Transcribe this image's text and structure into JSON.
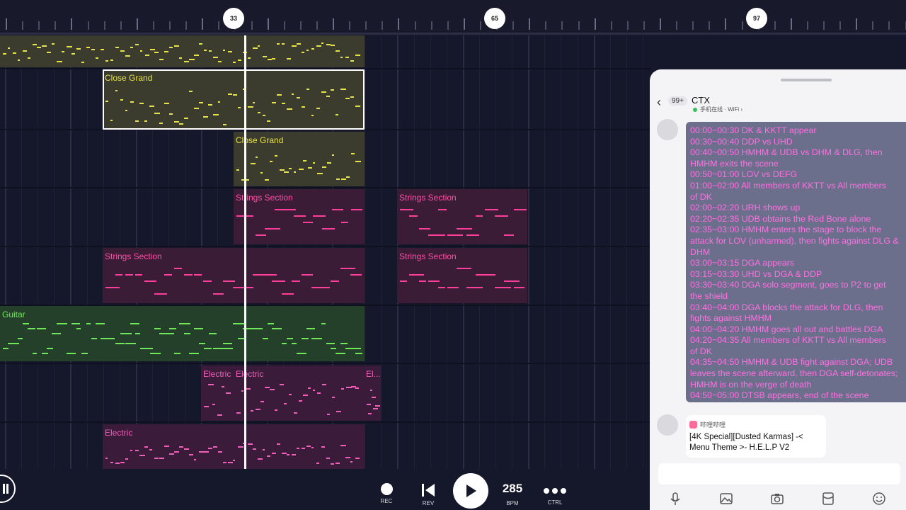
{
  "ruler": {
    "markers": [
      "33",
      "65",
      "97"
    ]
  },
  "tracks": {
    "clips": [
      {
        "id": "row1-a",
        "label": "",
        "color": "yellow"
      },
      {
        "id": "row2-a",
        "label": "Close Grand",
        "color": "yellow",
        "selected": true
      },
      {
        "id": "row3-a",
        "label": "Close Grand",
        "color": "yellow"
      },
      {
        "id": "row4-a",
        "label": "Strings Section",
        "color": "pink"
      },
      {
        "id": "row4-b",
        "label": "Strings Section",
        "color": "pink"
      },
      {
        "id": "row5-a",
        "label": "Strings Section",
        "color": "pink"
      },
      {
        "id": "row5-b",
        "label": "Strings Section",
        "color": "pink"
      },
      {
        "id": "row6-a",
        "label": "Guitar",
        "color": "green"
      },
      {
        "id": "row7-a",
        "label": "Electric",
        "color": "magenta"
      },
      {
        "id": "row7-b",
        "label": "Electric",
        "color": "magenta"
      },
      {
        "id": "row7-c",
        "label": "El...",
        "color": "magenta"
      },
      {
        "id": "row8-a",
        "label": "Electric",
        "color": "magenta"
      }
    ]
  },
  "transport": {
    "rec_label": "REC",
    "rev_label": "REV",
    "bpm_value": "285",
    "bpm_label": "BPM",
    "ctrl_label": "CTRL"
  },
  "chat": {
    "unread_badge": "99+",
    "contact_name": "CTX",
    "contact_status": "手机在线 · WiFi ›",
    "message_lines": [
      "00:00~00:30 DK & KKTT appear",
      "00:30~00:40 DDP vs UHD",
      "00:40~00:50 HMHM & UDB vs DHM & DLG, then",
      "HMHM exits the scene",
      "00:50~01:00 LOV vs DEFG",
      "01:00~02:00 All members of KKTT vs All members",
      "of DK",
      "02:00~02:20 URH shows up",
      "02:20~02:35 UDB obtains the Red Bone alone",
      "02:35~03:00 HMHM enters the stage to block the",
      "attack for LOV (unharmed), then fights against DLG &",
      "DHM",
      "03:00~03:15 DGA appears",
      "03:15~03:30 UHD vs DGA & DDP",
      "03:30~03:40 DGA solo segment, goes to P2 to get",
      "the shield",
      "03:40~04:00 DGA blocks the attack for DLG, then",
      "fights against HMHM",
      "04:00~04:20 HMHM goes all out and battles DGA",
      "04:20~04:35 All members of KKTT vs All members",
      "of DK",
      "04:35~04:50 HMHM & UDB fight against DGA; UDB",
      "leaves the scene afterward, then DGA self-detonates;",
      "HMHM is on the verge of death",
      "04:50~05:00 DTSB appears, end of the scene"
    ],
    "share_source": "哔哩哔哩",
    "share_title": "[4K Special][Dusted Karmas] -< Menu Theme >- H.E.L.P V2"
  },
  "colors": {
    "yellow_note": "#e7e34a",
    "pink_note": "#ff3f9a",
    "green_note": "#71e85a",
    "magenta_note": "#f05fb9",
    "chat_text": "#ff6fe1"
  }
}
